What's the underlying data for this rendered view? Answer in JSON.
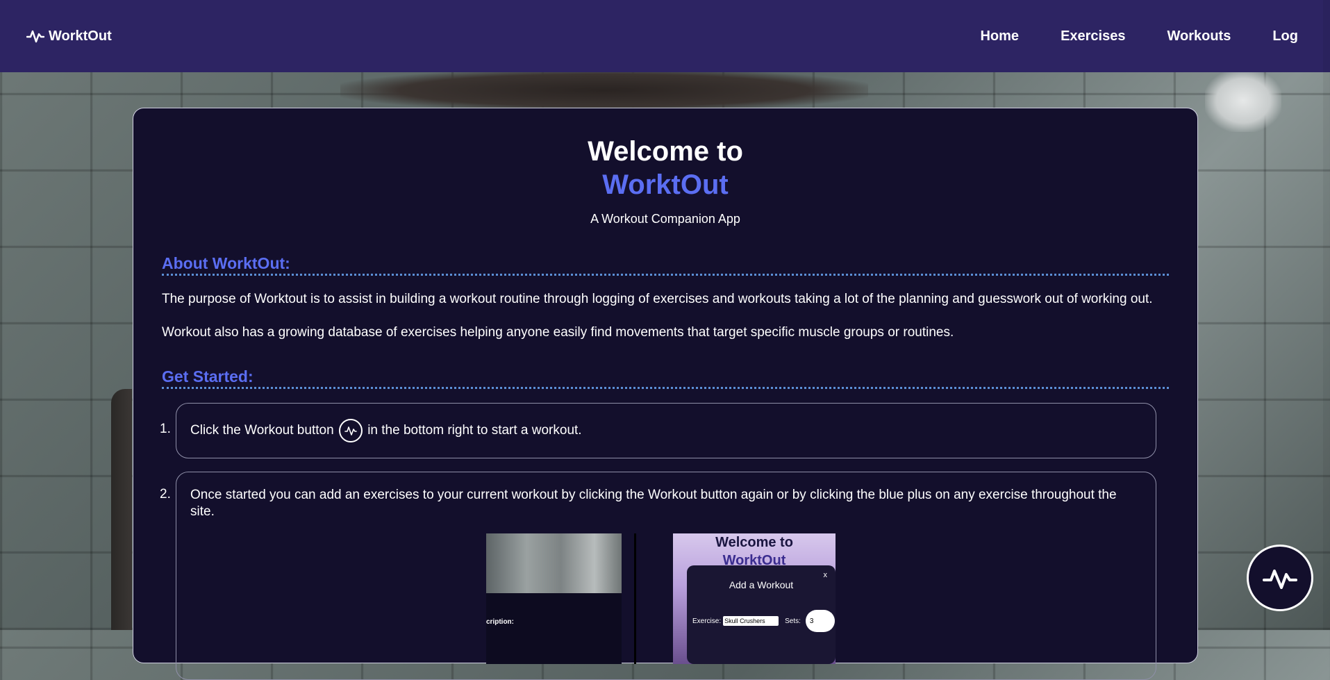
{
  "nav": {
    "brand": "WorktOut",
    "links": [
      "Home",
      "Exercises",
      "Workouts",
      "Log"
    ]
  },
  "hero": {
    "welcome": "Welcome to",
    "brand": "WorktOut",
    "subtitle": "A Workout Companion App"
  },
  "about": {
    "heading": "About WorktOut:",
    "line1": "The purpose of Worktout is to assist in building a workout routine through logging of exercises and workouts taking a lot of the planning and guesswork out of working out.",
    "line2": "Workout also has a growing database of exercises helping anyone easily find movements that target specific muscle groups or routines."
  },
  "get_started": {
    "heading": "Get Started:",
    "steps": [
      {
        "num": "1.",
        "before": "Click the Workout button",
        "after": "in the bottom right to start a workout."
      },
      {
        "num": "2.",
        "text": "Once started you can add an exercises to your current workout by clicking the Workout button again or by clicking the blue plus on any exercise throughout the site."
      }
    ]
  },
  "screenshot_left": {
    "desc_label": "cription:"
  },
  "screenshot_right": {
    "welcome": "Welcome to",
    "brand": "WorktOut",
    "modal_title": "Add a Workout",
    "close": "x",
    "exercise_label": "Exercise:",
    "exercise_value": "Skull Crushers",
    "sets_label": "Sets:",
    "sets_value": "3"
  },
  "icons": {
    "brand": "activity-icon",
    "inline": "activity-icon",
    "fab": "activity-icon"
  },
  "colors": {
    "nav_bg": "#2d2463",
    "card_bg": "#130f2c",
    "accent": "#5b6ef2"
  }
}
